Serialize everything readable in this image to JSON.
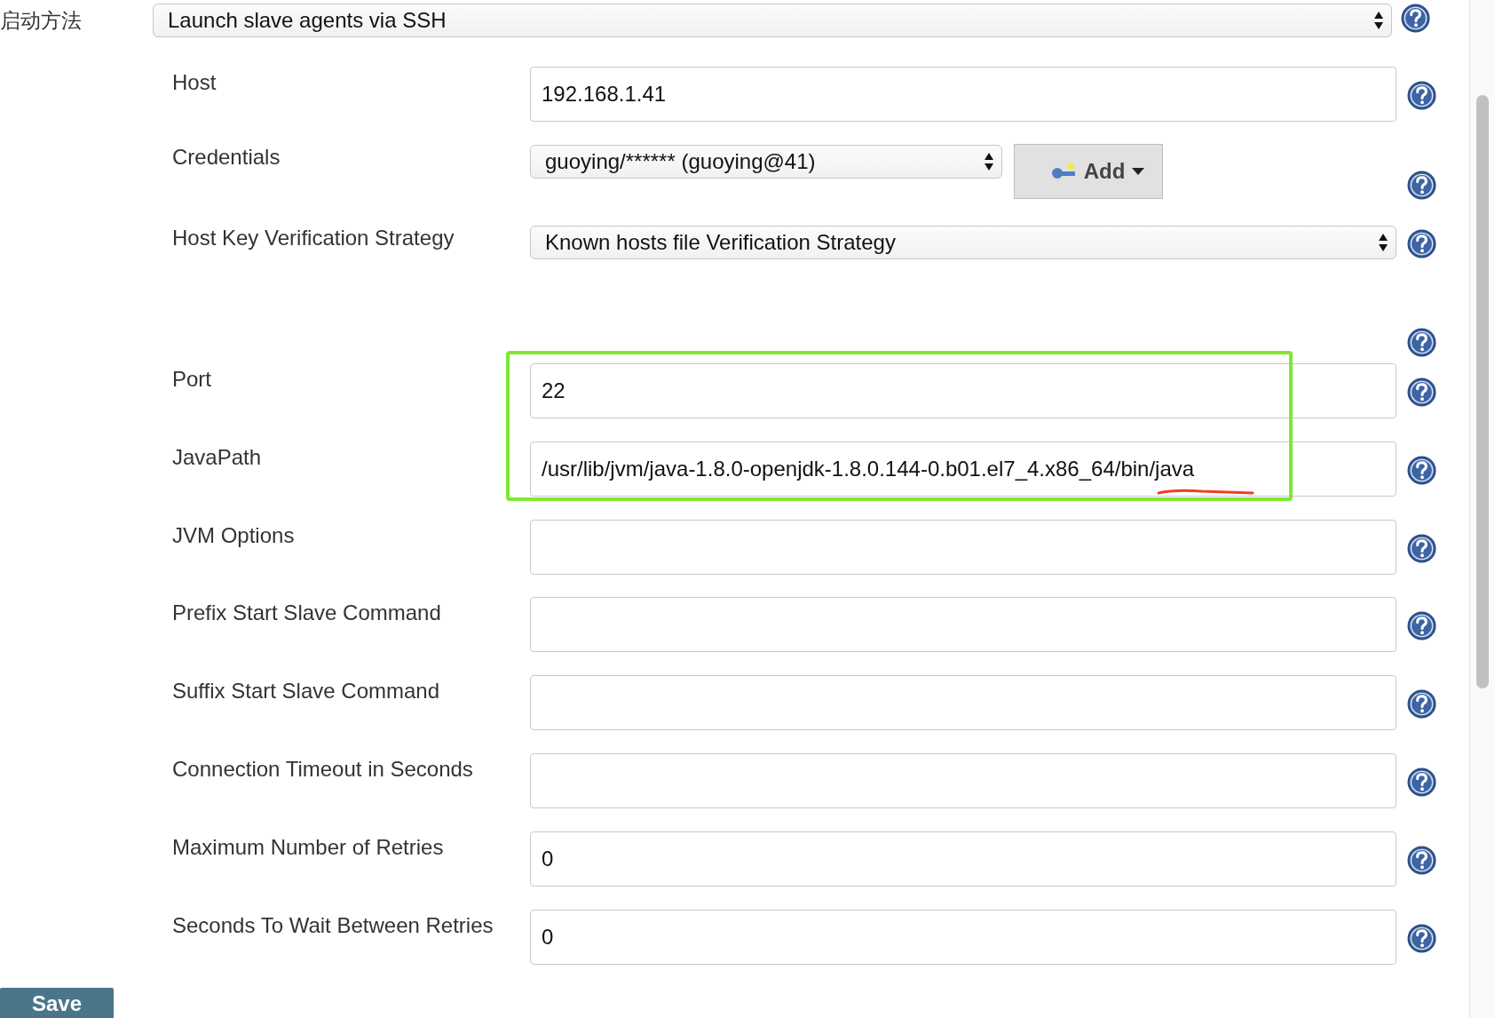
{
  "launch_method": {
    "label": "启动方法",
    "value": "Launch slave agents via SSH"
  },
  "fields": [
    {
      "kind": "text",
      "label": "Host",
      "value": "192.168.1.41"
    },
    {
      "kind": "select_add",
      "label": "Credentials",
      "value": "guoying/****** (guoying@41)",
      "button": "Add"
    },
    {
      "kind": "select",
      "label": "Host Key Verification Strategy",
      "value": "Known hosts file Verification Strategy"
    },
    {
      "kind": "help"
    },
    {
      "kind": "text",
      "label": "Port",
      "value": "22",
      "highlighted": true
    },
    {
      "kind": "text",
      "label": "JavaPath",
      "value": "/usr/lib/jvm/java-1.8.0-openjdk-1.8.0.144-0.b01.el7_4.x86_64/bin/java",
      "highlighted": true
    },
    {
      "kind": "text",
      "label": "JVM Options"
    },
    {
      "kind": "text",
      "label": "Prefix Start Slave Command"
    },
    {
      "kind": "text",
      "label": "Suffix Start Slave Command"
    },
    {
      "kind": "text",
      "label": "Connection Timeout in Seconds"
    },
    {
      "kind": "text",
      "label": "Maximum Number of Retries",
      "value": "0"
    },
    {
      "kind": "text",
      "label": "Seconds To Wait Between Retries",
      "value": "0"
    }
  ],
  "save_button": "Save"
}
